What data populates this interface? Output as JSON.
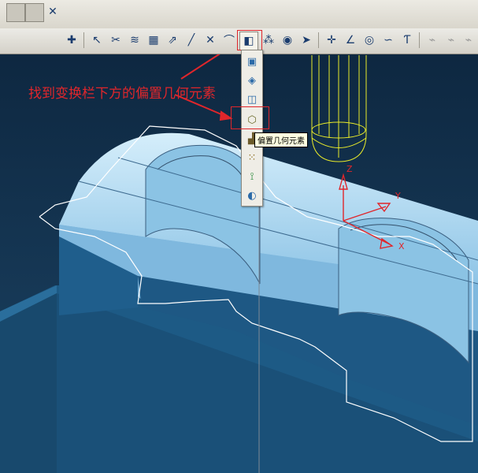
{
  "tooltip": {
    "text": "偏置几何元素"
  },
  "annotation": {
    "text": "找到变换栏下方的偏置几何元素"
  },
  "axes": {
    "x": "X",
    "y": "Y",
    "z": "Z"
  },
  "colors": {
    "accent": "#e0262b",
    "part": "#a9d6f0",
    "fixture": "#1d5a85",
    "tool": "#e8ea2a"
  },
  "toolbar": {
    "icons": [
      "add-icon",
      "select-icon",
      "scissors-icon",
      "curve-icon",
      "table-icon",
      "measure-icon",
      "line-icon",
      "trim-icon",
      "fillet-icon",
      "transform-icon",
      "array-icon",
      "view-icon",
      "project-icon",
      "point-icon",
      "angle-icon",
      "circle-icon",
      "spline-icon",
      "text-icon"
    ]
  },
  "dropdown": {
    "items": [
      "move-icon",
      "rotate-icon",
      "mirror-icon",
      "offset-geometry-icon",
      "scale-icon",
      "array-icon",
      "pattern-icon",
      "project-icon"
    ]
  }
}
